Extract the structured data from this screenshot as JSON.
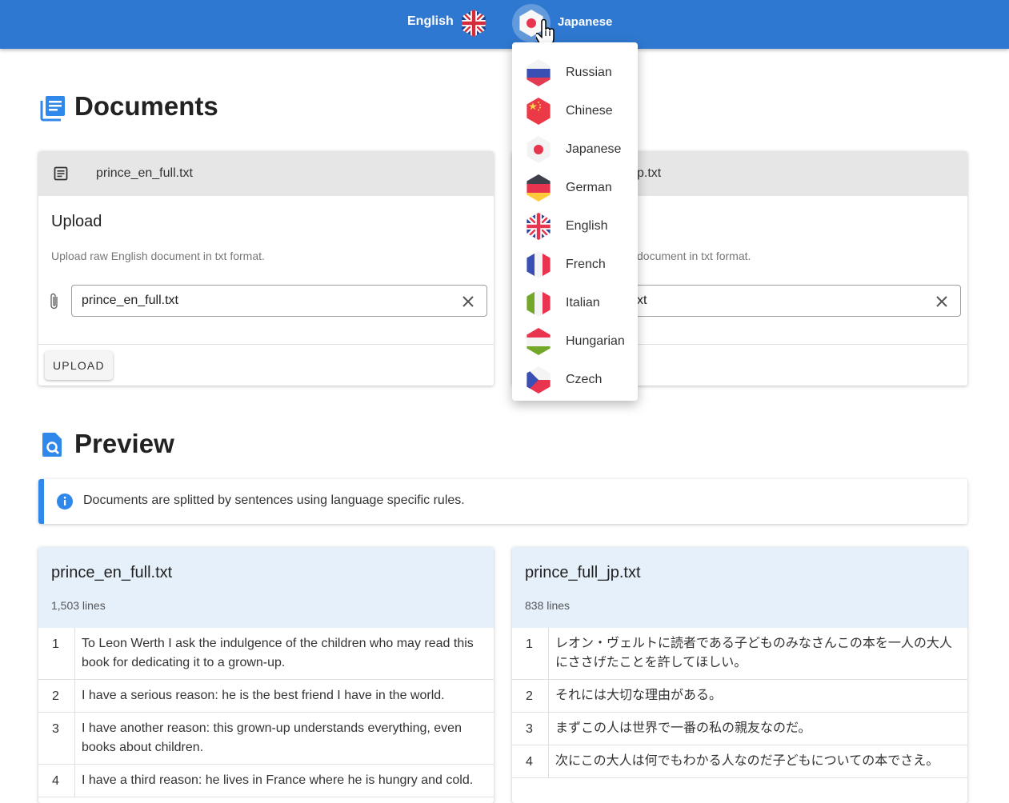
{
  "header": {
    "source_language": "English",
    "target_language": "Japanese"
  },
  "language_menu": {
    "items": [
      {
        "label": "Russian",
        "icon": "flag-russia-icon"
      },
      {
        "label": "Chinese",
        "icon": "flag-china-icon"
      },
      {
        "label": "Japanese",
        "icon": "flag-japan-icon"
      },
      {
        "label": "German",
        "icon": "flag-germany-icon"
      },
      {
        "label": "English",
        "icon": "flag-uk-icon"
      },
      {
        "label": "French",
        "icon": "flag-france-icon"
      },
      {
        "label": "Italian",
        "icon": "flag-italy-icon"
      },
      {
        "label": "Hungarian",
        "icon": "flag-hungary-icon"
      },
      {
        "label": "Czech",
        "icon": "flag-czech-icon"
      }
    ]
  },
  "documents": {
    "title": "Documents",
    "left": {
      "file_name": "prince_en_full.txt",
      "upload_title": "Upload",
      "upload_hint": "Upload raw English document in txt format.",
      "input_value": "prince_en_full.txt",
      "upload_label": "UPLOAD"
    },
    "right": {
      "file_name_visible": "p.txt",
      "upload_hint_visible": "document in txt format.",
      "input_value_visible": "xt"
    }
  },
  "preview": {
    "title": "Preview",
    "info": "Documents are splitted by sentences using language specific rules.",
    "left": {
      "file_name": "prince_en_full.txt",
      "lines": "1,503 lines",
      "rows": [
        {
          "n": "1",
          "text": "To Leon Werth I ask the indulgence of the children who may read this book for dedicating it to a grown-up."
        },
        {
          "n": "2",
          "text": "I have a serious reason: he is the best friend I have in the world."
        },
        {
          "n": "3",
          "text": "I have another reason: this grown-up understands everything, even books about children."
        },
        {
          "n": "4",
          "text": "I have a third reason: he lives in France where he is hungry and cold."
        }
      ]
    },
    "right": {
      "file_name": "prince_full_jp.txt",
      "lines": "838 lines",
      "rows": [
        {
          "n": "1",
          "text": "レオン・ヴェルトに読者である子どものみなさんこの本を一人の大人にささげたことを許してほしい。"
        },
        {
          "n": "2",
          "text": "それには大切な理由がある。"
        },
        {
          "n": "3",
          "text": "まずこの人は世界で一番の私の親友なのだ。"
        },
        {
          "n": "4",
          "text": "次にこの大人は何でもわかる人なのだ子どもについての本でさえ。"
        }
      ]
    }
  },
  "colors": {
    "topbar": "#2f78d1",
    "accent": "#2f88ea",
    "preview_header": "#e5f0fb"
  }
}
